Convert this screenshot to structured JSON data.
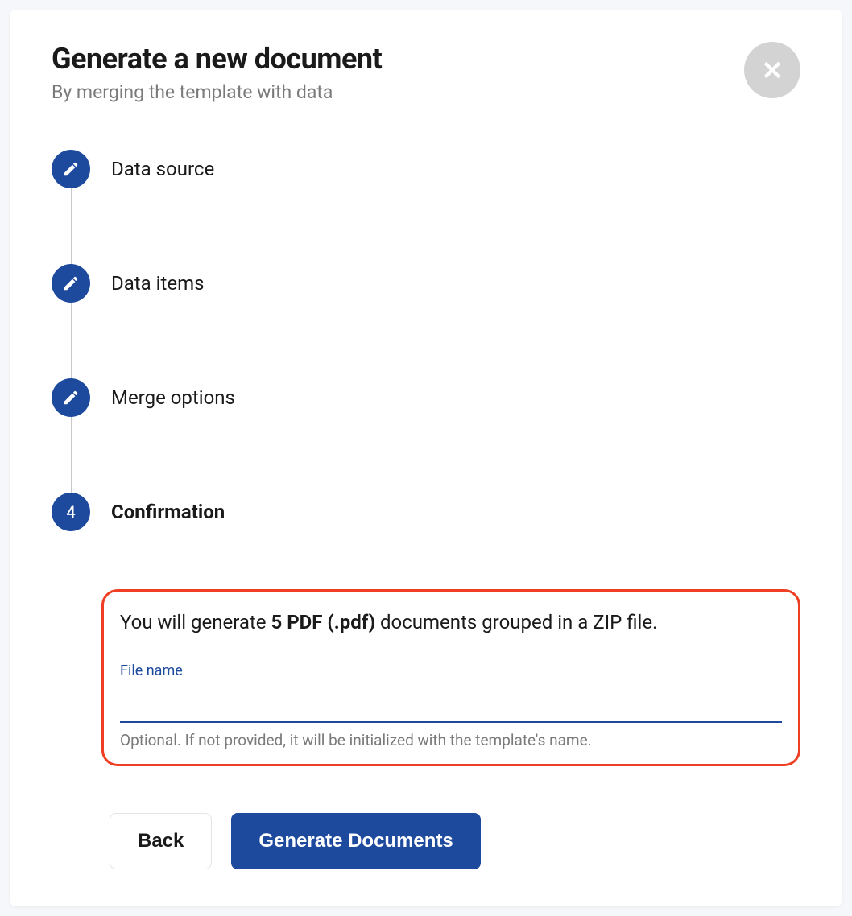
{
  "header": {
    "title": "Generate a new document",
    "subtitle": "By merging the template with data"
  },
  "stepper": {
    "steps": [
      {
        "label": "Data source",
        "type": "edit"
      },
      {
        "label": "Data items",
        "type": "edit"
      },
      {
        "label": "Merge options",
        "type": "edit"
      },
      {
        "label": "Confirmation",
        "type": "number",
        "number": "4",
        "active": true
      }
    ]
  },
  "confirmation": {
    "message_prefix": "You will generate ",
    "message_bold": "5 PDF (.pdf)",
    "message_suffix": " documents grouped in a ZIP file.",
    "field_label": "File name",
    "field_value": "",
    "field_helper": "Optional. If not provided, it will be initialized with the template's name."
  },
  "buttons": {
    "back": "Back",
    "generate": "Generate Documents"
  }
}
